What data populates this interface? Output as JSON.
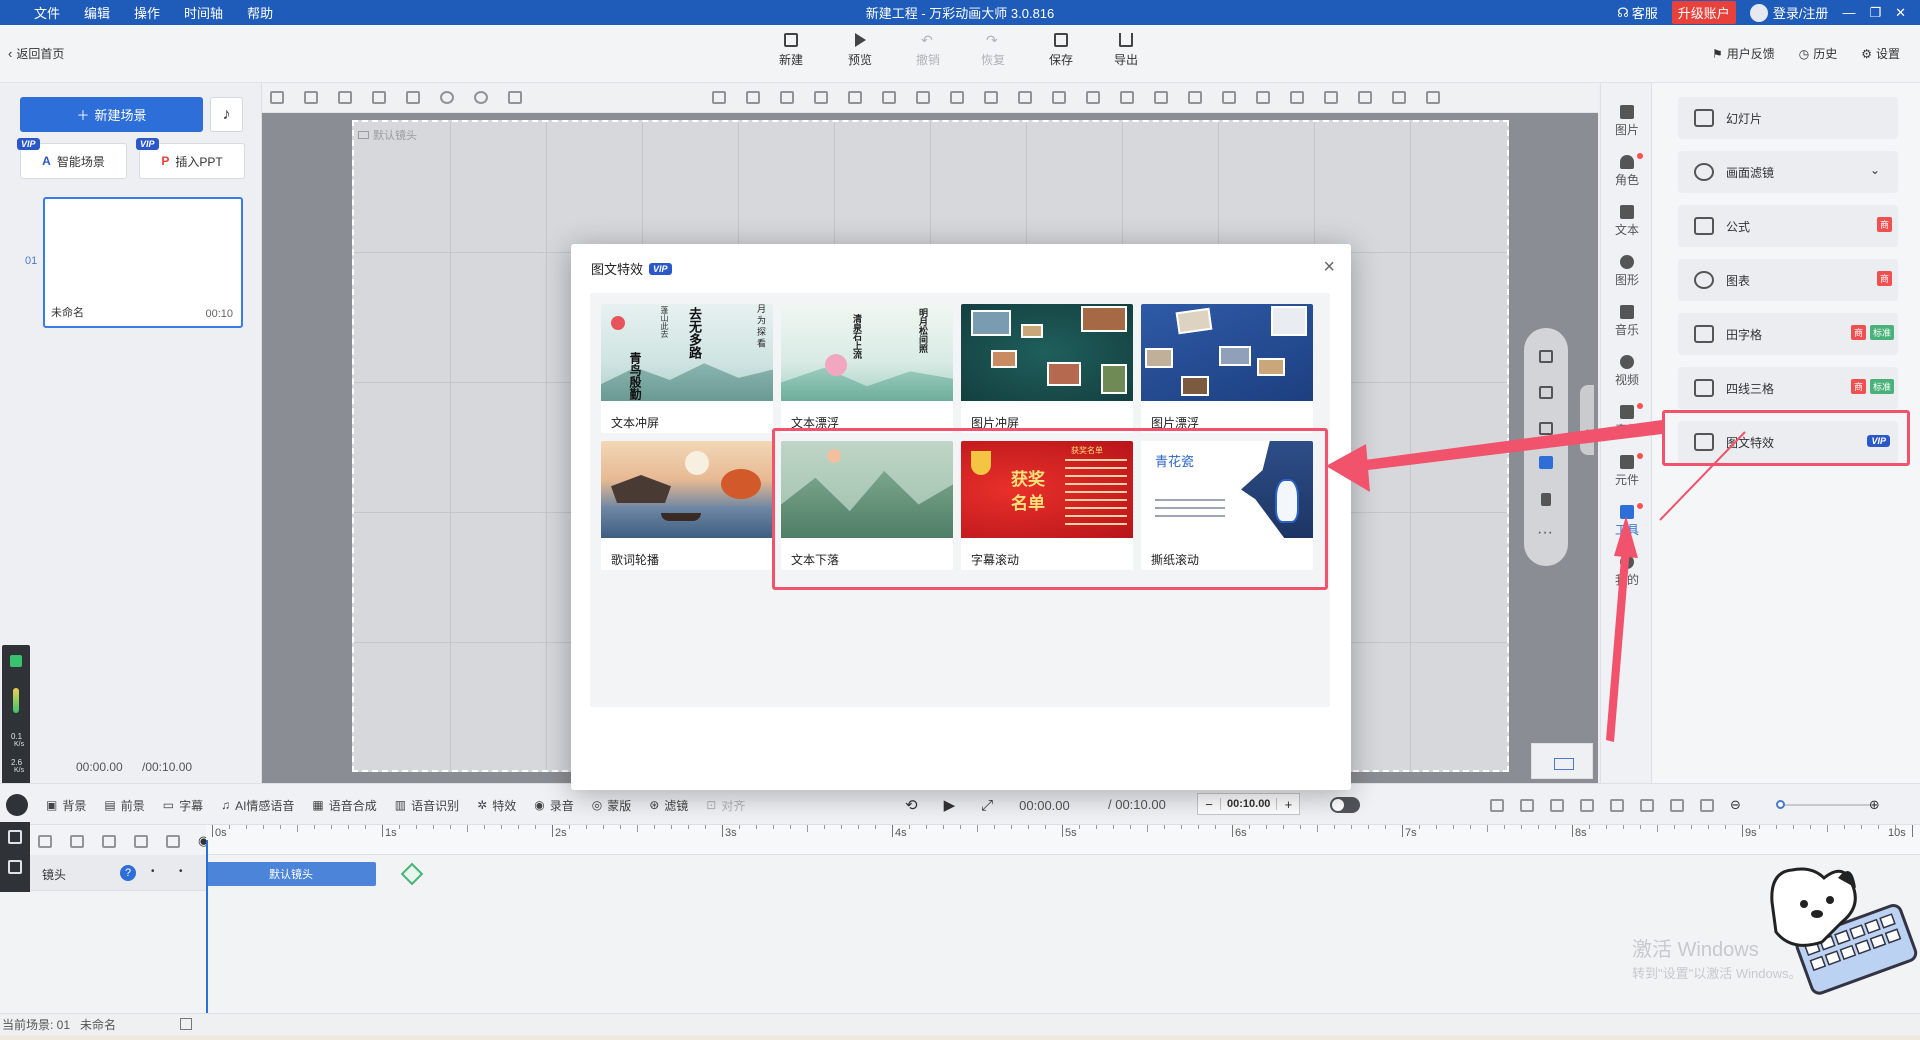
{
  "titlebar": {
    "menus": [
      "文件",
      "编辑",
      "操作",
      "时间轴",
      "帮助"
    ],
    "title": "新建工程 - 万彩动画大师 3.0.816",
    "service": "客服",
    "upgrade": "升级账户",
    "login": "登录/注册"
  },
  "toolbar": {
    "back": "返回首页",
    "buttons": [
      "新建",
      "预览",
      "撤销",
      "恢复",
      "保存",
      "导出"
    ],
    "right": [
      "用户反馈",
      "历史",
      "设置"
    ]
  },
  "left": {
    "new_scene": "新建场景",
    "smart_scene": "智能场景",
    "insert_ppt": "插入PPT",
    "vip": "VIP",
    "scene_index": "01",
    "scene_name": "未命名",
    "scene_duration": "00:10",
    "time_current": "00:00.00",
    "time_total": "/00:10.00",
    "meter_top": "0.1",
    "meter_top_unit": "K/s",
    "meter_bottom": "2.6",
    "meter_bottom_unit": "K/s"
  },
  "canvas": {
    "default_shot": "默认镜头"
  },
  "side_nav": [
    "图片",
    "角色",
    "文本",
    "图形",
    "音乐",
    "视频",
    "素材",
    "元件",
    "工具",
    "我的"
  ],
  "right_panel": {
    "items": [
      "幻灯片",
      "画面滤镜",
      "公式",
      "图表",
      "田字格",
      "四线三格",
      "图文特效"
    ],
    "badge_shang": "商",
    "badge_biaozhun": "标准",
    "vip": "VIP"
  },
  "modal": {
    "title": "图文特效",
    "vip": "VIP",
    "close": "×",
    "cards": [
      {
        "label": "文本冲屏"
      },
      {
        "label": "文本漂浮"
      },
      {
        "label": "图片冲屏"
      },
      {
        "label": "图片漂浮"
      },
      {
        "label": "歌词轮播"
      },
      {
        "label": "文本下落"
      },
      {
        "label": "字幕滚动"
      },
      {
        "label": "撕纸滚动"
      }
    ],
    "thumb_texts": {
      "c1_big": "去无多路",
      "c1_big2": "青鸟殷勤",
      "c1_side": "蓬山此去",
      "c1_side2": "月 为 探 看",
      "c2_big": "清泉石上流",
      "c2_side": "明月松间照",
      "c7_title": "获奖名单",
      "c7_big": "获奖",
      "c7_big2": "名单",
      "c8_title": "青花瓷"
    }
  },
  "timeline": {
    "tools": [
      "背景",
      "前景",
      "字幕",
      "AI情感语音",
      "语音合成",
      "语音识别",
      "特效",
      "录音",
      "蒙版",
      "滤镜",
      "对齐"
    ],
    "time_current": "00:00.00",
    "time_total": "/ 00:10.00",
    "duration_box": "00:10.00",
    "ticks": [
      "0s",
      "1s",
      "2s",
      "3s",
      "4s",
      "5s",
      "6s",
      "7s",
      "8s",
      "9s",
      "10s"
    ],
    "track_name": "镜头",
    "clip_label": "默认镜头"
  },
  "status": {
    "current_scene": "当前场景: 01",
    "scene_name": "未命名"
  },
  "watermark": {
    "line1": "激活 Windows",
    "line2": "转到\"设置\"以激活 Windows。"
  },
  "colors": {
    "titlebar": "#1f5bb9",
    "accent": "#2d6ed8",
    "highlight": "#f0536b",
    "upgrade": "#e8403a"
  }
}
